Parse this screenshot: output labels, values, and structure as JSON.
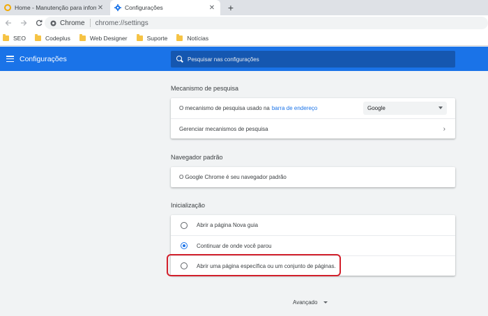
{
  "browser": {
    "tabs": [
      {
        "title": "Home - Manutenção para inform",
        "close": "✕"
      },
      {
        "title": "Configurações",
        "close": "✕"
      }
    ],
    "new_tab": "+",
    "omnibox": {
      "site": "Chrome",
      "url": "chrome://settings"
    }
  },
  "bookmarks": [
    "SEO",
    "Codeplus",
    "Web Designer",
    "Suporte",
    "Notícias"
  ],
  "header": {
    "title": "Configurações",
    "search_placeholder": "Pesquisar nas configurações"
  },
  "search_engine": {
    "title": "Mecanismo de pesquisa",
    "row1_text": "O mecanismo de pesquisa usado na",
    "row1_link": "barra de endereço",
    "selected": "Google",
    "row2_text": "Gerenciar mecanismos de pesquisa"
  },
  "default_browser": {
    "title": "Navegador padrão",
    "status": "O Google Chrome é seu navegador padrão"
  },
  "startup": {
    "title": "Inicialização",
    "options": [
      {
        "label": "Abrir a página Nova guia",
        "checked": false
      },
      {
        "label": "Continuar de onde você parou",
        "checked": true
      },
      {
        "label": "Abrir uma página específica ou um conjunto de páginas.",
        "checked": false
      }
    ]
  },
  "advanced_label": "Avançado",
  "colors": {
    "accent": "#1a73e8",
    "highlight_border": "#d21f2b"
  }
}
